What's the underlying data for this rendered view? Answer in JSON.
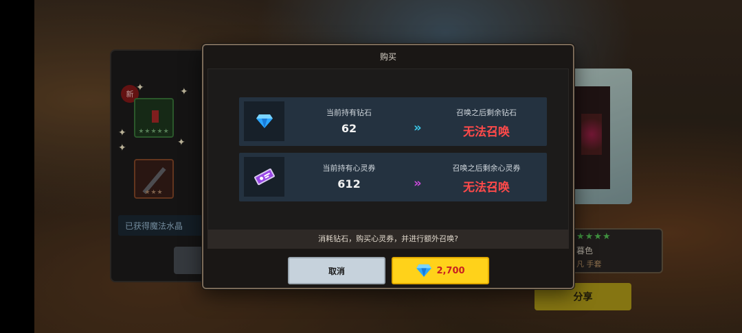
{
  "background": {
    "new_badge": "新",
    "item_stars": [
      "★★★★★",
      "★★★"
    ],
    "info_text": "已获得魔法水晶",
    "banner_stars": "★★★★",
    "banner_name": "暮色",
    "banner_sub": "凡 手套",
    "share_label": "分享"
  },
  "dialog": {
    "title": "购买",
    "rows": [
      {
        "icon": "diamond-icon",
        "current_label": "当前持有钻石",
        "current_value": "62",
        "arrow": "»",
        "after_label": "召唤之后剩余钻石",
        "after_value": "无法召唤"
      },
      {
        "icon": "ticket-icon",
        "current_label": "当前持有心灵券",
        "current_value": "612",
        "arrow": "»",
        "after_label": "召唤之后剩余心灵券",
        "after_value": "无法召唤"
      }
    ],
    "note": "消耗钻石，购买心灵券，并进行额外召唤?",
    "cancel_label": "取消",
    "buy_price": "2,700"
  },
  "colors": {
    "error_red": "#ff4a4a",
    "buy_yellow": "#ffd21a",
    "diamond_arrow": "#3ac8e8",
    "ticket_arrow": "#c84ad8"
  }
}
